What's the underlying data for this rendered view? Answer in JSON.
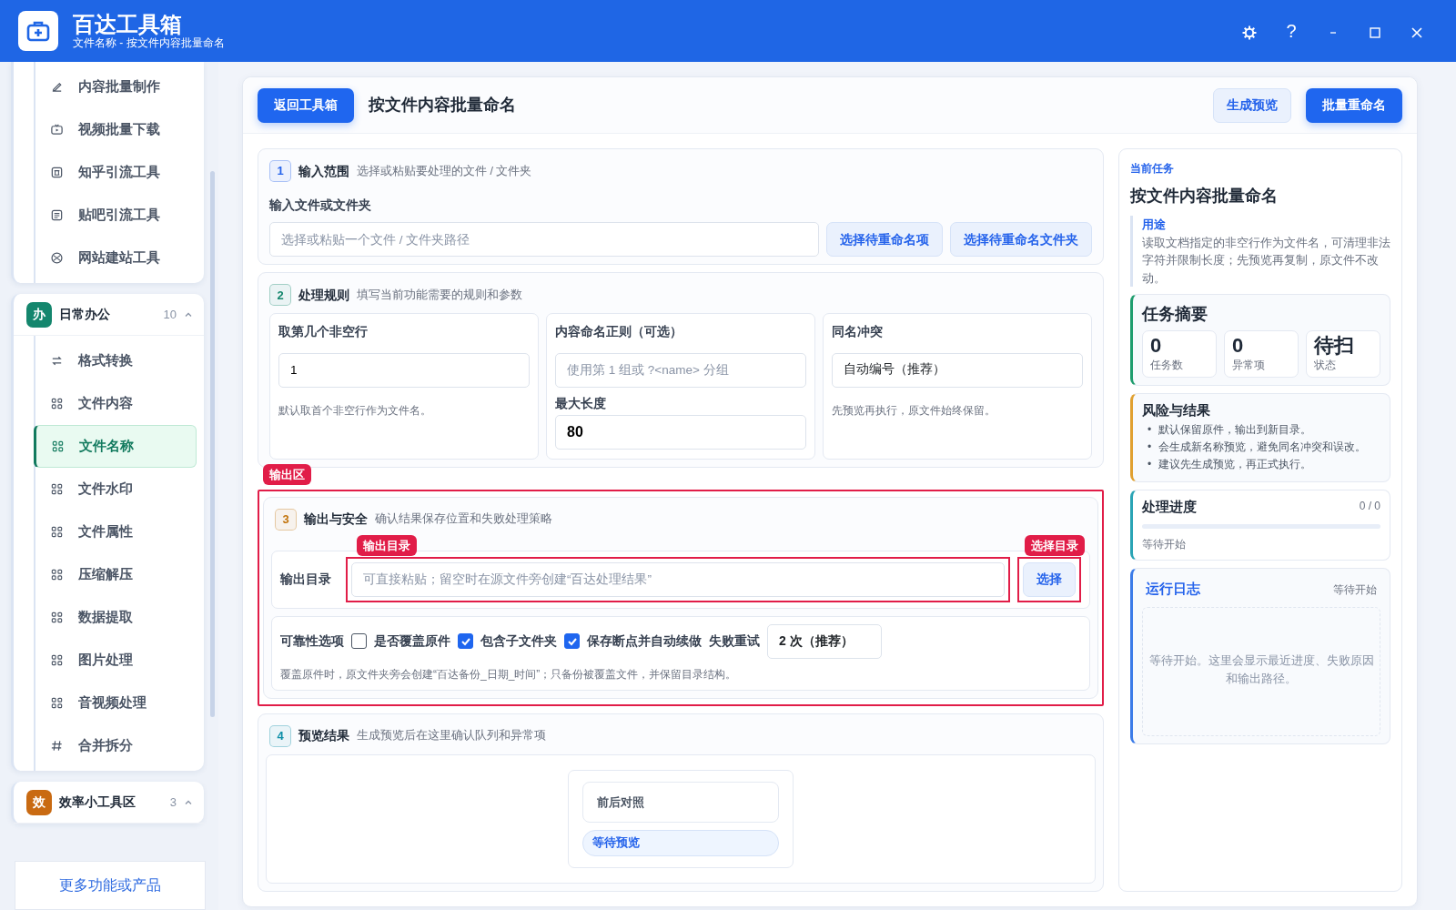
{
  "app": {
    "title": "百达工具箱",
    "subtitle": "文件名称 - 按文件内容批量命名",
    "help": "?"
  },
  "sidebar": {
    "groups": [
      {
        "items": [
          {
            "label": "内容批量制作",
            "kind": "pen",
            "selected": false
          },
          {
            "label": "视频批量下载",
            "kind": "video",
            "selected": false
          },
          {
            "label": "知乎引流工具",
            "kind": "square",
            "selected": false
          },
          {
            "label": "贴吧引流工具",
            "kind": "note",
            "selected": false
          },
          {
            "label": "网站建站工具",
            "kind": "globe",
            "selected": false
          }
        ]
      },
      {
        "badge": "办",
        "color": "#14866d",
        "title": "日常办公",
        "count": "10",
        "expanded": true,
        "items": [
          {
            "label": "格式转换",
            "kind": "swap",
            "selected": false
          },
          {
            "label": "文件内容",
            "kind": "grid",
            "selected": false
          },
          {
            "label": "文件名称",
            "kind": "grid",
            "selected": true
          },
          {
            "label": "文件水印",
            "kind": "grid",
            "selected": false
          },
          {
            "label": "文件属性",
            "kind": "grid",
            "selected": false
          },
          {
            "label": "压缩解压",
            "kind": "grid",
            "selected": false
          },
          {
            "label": "数据提取",
            "kind": "grid",
            "selected": false
          },
          {
            "label": "图片处理",
            "kind": "grid",
            "selected": false
          },
          {
            "label": "音视频处理",
            "kind": "grid",
            "selected": false
          },
          {
            "label": "合并拆分",
            "kind": "hash",
            "selected": false
          }
        ]
      },
      {
        "badge": "效",
        "color": "#c96a12",
        "title": "效率小工具区",
        "count": "3",
        "expanded": true
      }
    ],
    "footer_link": "更多功能或产品"
  },
  "toolbar": {
    "back_button": "返回工具箱",
    "title": "按文件内容批量命名",
    "buttons": [
      {
        "label": "生成预览",
        "kind": "secondary"
      },
      {
        "label": "批量重命名",
        "kind": "primary"
      }
    ]
  },
  "sections": [
    {
      "number": "1",
      "color": "#2563eb",
      "title": "输入范围",
      "hint": "选择或粘贴要处理的文件 / 文件夹",
      "kind": "input",
      "field_label": "输入文件或文件夹",
      "placeholder": "选择或粘贴一个文件 / 文件夹路径",
      "buttons": [
        "选择待重命名项",
        "选择待重命名文件夹"
      ]
    },
    {
      "number": "2",
      "color": "#14866d",
      "title": "处理规则",
      "hint": "填写当前功能需要的规则和参数",
      "kind": "rules",
      "columns": [
        {
          "label": "取第几个非空行",
          "fields": [
            {
              "kind": "input",
              "value": "1"
            }
          ],
          "note": "默认取首个非空行作为文件名。"
        },
        {
          "label": "内容命名正则（可选）",
          "fields": [
            {
              "kind": "input",
              "placeholder": "使用第 1 组或 ?<name> 分组"
            },
            {
              "kind": "number",
              "label": "最大长度",
              "value": "80"
            }
          ]
        },
        {
          "label": "同名冲突",
          "fields": [
            {
              "kind": "select",
              "value": "自动编号（推荐）"
            }
          ],
          "note": "先预览再执行，原文件始终保留。"
        }
      ]
    },
    {
      "number": "3",
      "color": "#c2740c",
      "title": "输出与安全",
      "hint": "确认结果保存位置和失败处理策略",
      "kind": "output",
      "annotation": "输出区",
      "output": {
        "label": "输出目录",
        "placeholder": "可直接粘贴；留空时在源文件旁创建“百达处理结果”",
        "annotation": "输出目录",
        "button": "选择",
        "button_annotation": "选择目录"
      },
      "reliability": {
        "label": "可靠性选项",
        "options": [
          {
            "label": "是否覆盖原件",
            "checked": false
          },
          {
            "label": "包含子文件夹",
            "checked": true
          },
          {
            "label": "保存断点并自动续做",
            "checked": true
          }
        ],
        "retry_label": "失败重试",
        "retry_value": "2 次（推荐）",
        "note": "覆盖原件时，原文件夹旁会创建“百达备份_日期_时间”；只备份被覆盖文件，并保留目录结构。"
      }
    },
    {
      "number": "4",
      "color": "#0e8fa8",
      "title": "预览结果",
      "hint": "生成预览后在这里确认队列和异常项",
      "kind": "preview",
      "preview": {
        "title": "前后对照",
        "status": "等待预览"
      }
    }
  ],
  "task": {
    "eyebrow": "当前任务",
    "title": "按文件内容批量命名",
    "purpose_label": "用途",
    "purpose": "读取文档指定的非空行作为文件名，可清理非法字符并限制长度；先预览再复制，原文件不改动。",
    "summary": {
      "title": "任务摘要",
      "stats": [
        {
          "value": "0",
          "label": "任务数"
        },
        {
          "value": "0",
          "label": "异常项"
        },
        {
          "value": "待扫",
          "label": "状态"
        }
      ]
    },
    "risks": {
      "title": "风险与结果",
      "items": [
        {
          "bullet": "•",
          "text": "默认保留原件，输出到新目录。"
        },
        {
          "bullet": "•",
          "text": "会生成新名称预览，避免同名冲突和误改。"
        },
        {
          "bullet": "•",
          "text": "建议先生成预览，再正式执行。"
        }
      ]
    },
    "progress": {
      "title": "处理进度",
      "count": "0 / 0",
      "level": 0,
      "status": "等待开始"
    },
    "log": {
      "title": "运行日志",
      "status": "等待开始",
      "placeholder": "等待开始。这里会显示最近进度、失败原因和输出路径。"
    }
  }
}
